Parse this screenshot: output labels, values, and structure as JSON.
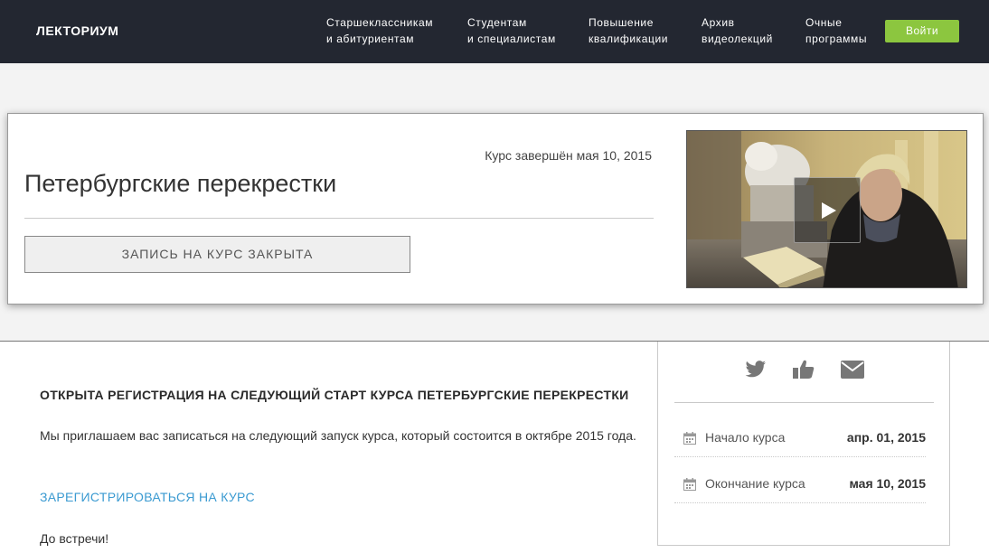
{
  "header": {
    "logo": "ЛЕКТОРИУМ",
    "nav": [
      {
        "line1": "Старшеклассникам",
        "line2": "и абитуриентам"
      },
      {
        "line1": "Студентам",
        "line2": "и специалистам"
      },
      {
        "line1": "Повышение",
        "line2": "квалификации"
      },
      {
        "line1": "Архив",
        "line2": "видеолекций"
      },
      {
        "line1": "Очные",
        "line2": "программы"
      }
    ],
    "login_label": "Войти"
  },
  "course": {
    "end_status": "Курс завершён мая 10, 2015",
    "title": "Петербургские перекрестки",
    "enroll_label": "ЗАПИСЬ НА КУРС ЗАКРЫТА",
    "video_icon": "play-icon"
  },
  "announcement": {
    "title": "ОТКРЫТА РЕГИСТРАЦИЯ НА СЛЕДУЮЩИЙ СТАРТ КУРСА ПЕТЕРБУРГСКИЕ ПЕРЕКРЕСТКИ",
    "text": "Мы приглашаем вас записаться на следующий запуск курса, который состоится в октябре 2015 года.",
    "register_link": "ЗАРЕГИСТРИРОВАТЬСЯ НА КУРС",
    "farewell": "До встречи!"
  },
  "sidebar": {
    "share_icons": [
      "twitter-icon",
      "thumbs-up-icon",
      "envelope-icon"
    ],
    "start_label": "Начало курса",
    "start_value": "апр. 01, 2015",
    "end_label": "Окончание курса",
    "end_value": "мая 10, 2015"
  },
  "colors": {
    "header_bg": "#232731",
    "accent_green": "#8cc63f",
    "link_blue": "#3a9ad1",
    "icon_gray": "#777777"
  }
}
